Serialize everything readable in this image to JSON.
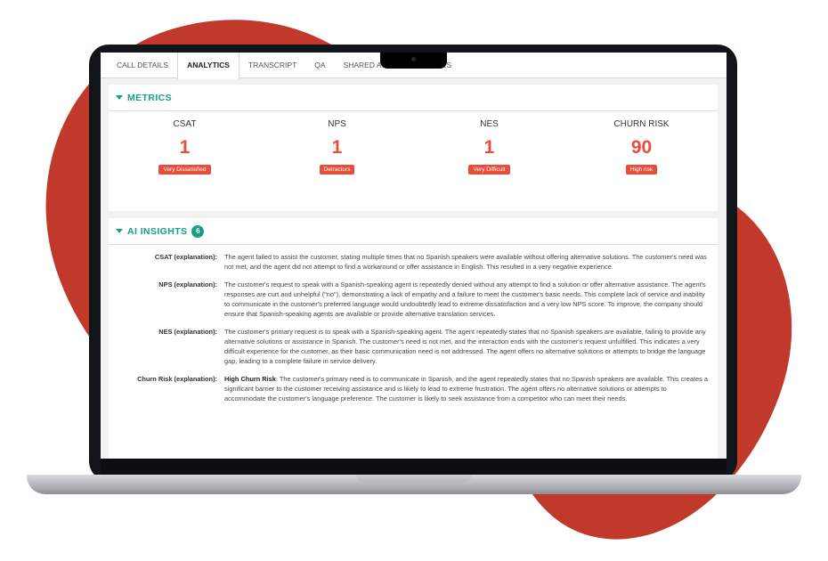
{
  "tabs": [
    {
      "label": "CALL DETAILS",
      "active": false
    },
    {
      "label": "ANALYTICS",
      "active": true
    },
    {
      "label": "TRANSCRIPT",
      "active": false
    },
    {
      "label": "QA",
      "active": false
    },
    {
      "label": "SHARED ACCESS",
      "active": false
    },
    {
      "label": "NOTES",
      "active": false
    }
  ],
  "metrics": {
    "title": "METRICS",
    "items": [
      {
        "label": "CSAT",
        "value": "1",
        "badge": "Very Dissatisfied"
      },
      {
        "label": "NPS",
        "value": "1",
        "badge": "Detractors"
      },
      {
        "label": "NES",
        "value": "1",
        "badge": "Very Difficult"
      },
      {
        "label": "CHURN RISK",
        "value": "90",
        "badge": "High risk"
      }
    ]
  },
  "insights": {
    "title": "AI INSIGHTS",
    "count": "6",
    "items": [
      {
        "label": "CSAT (explanation):",
        "lead": "",
        "text": "The agent failed to assist the customer, stating multiple times that no Spanish speakers were available without offering alternative solutions. The customer's need was not met, and the agent did not attempt to find a workaround or offer assistance in English. This resulted in a very negative experience."
      },
      {
        "label": "NPS (explanation):",
        "lead": "",
        "text": "The customer's request to speak with a Spanish-speaking agent is repeatedly denied without any attempt to find a solution or offer alternative assistance. The agent's responses are curt and unhelpful (\"no\"), demonstrating a lack of empathy and a failure to meet the customer's basic needs. This complete lack of service and inability to communicate in the customer's preferred language would undoubtedly lead to extreme dissatisfaction and a very low NPS score. To improve, the company should ensure that Spanish-speaking agents are available or provide alternative translation services."
      },
      {
        "label": "NES (explanation):",
        "lead": "",
        "text": "The customer's primary request is to speak with a Spanish-speaking agent. The agent repeatedly states that no Spanish speakers are available, failing to provide any alternative solutions or assistance in Spanish. The customer's need is not met, and the interaction ends with the customer's request unfulfilled. This indicates a very difficult experience for the customer, as their basic communication need is not addressed. The agent offers no alternative solutions or attempts to bridge the language gap, leading to a complete failure in service delivery."
      },
      {
        "label": "Churn Risk (explanation):",
        "lead": "High Churn Risk",
        "text": ": The customer's primary need is to communicate in Spanish, and the agent repeatedly states that no Spanish speakers are available. This creates a significant barrier to the customer receiving assistance and is likely to lead to extreme frustration. The agent offers no alternative solutions or attempts to accommodate the customer's language preference. The customer is likely to seek assistance from a competitor who can meet their needs."
      }
    ]
  },
  "colors": {
    "accent": "#16a085",
    "alert": "#e74c3c",
    "blob": "#c0392b"
  }
}
